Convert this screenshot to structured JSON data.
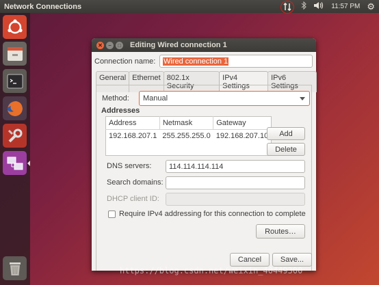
{
  "topbar": {
    "title": "Network Connections",
    "time": "11:57 PM",
    "icons": [
      "network-arrows-icon",
      "bluetooth-icon",
      "volume-icon",
      "gear-icon"
    ]
  },
  "launcher": {
    "items": [
      "ubuntu-dash-icon",
      "files-icon",
      "terminal-icon",
      "firefox-icon",
      "system-settings-icon",
      "network-settings-icon",
      "trash-icon"
    ]
  },
  "dialog": {
    "title": "Editing Wired connection 1",
    "connection_name_label": "Connection name:",
    "connection_name_value": "Wired connection 1",
    "tabs": [
      "General",
      "Ethernet",
      "802.1x Security",
      "IPv4 Settings",
      "IPv6 Settings"
    ],
    "active_tab": "IPv4 Settings",
    "method_label": "Method:",
    "method_value": "Manual",
    "addresses_label": "Addresses",
    "table": {
      "headers": [
        "Address",
        "Netmask",
        "Gateway"
      ],
      "rows": [
        [
          "192.168.207.1",
          "255.255.255.0",
          "192.168.207.10"
        ]
      ]
    },
    "add_label": "Add",
    "delete_label": "Delete",
    "dns_label": "DNS servers:",
    "dns_value": "114.114.114.114",
    "search_domains_label": "Search domains:",
    "search_domains_value": "",
    "dhcp_client_id_label": "DHCP client ID:",
    "dhcp_client_id_value": "",
    "require_ipv4_label": "Require IPv4 addressing for this connection to complete",
    "require_ipv4_checked": false,
    "routes_label": "Routes…",
    "cancel_label": "Cancel",
    "save_label": "Save..."
  },
  "watermark": "https://blog.csdn.net/weixin_40449300",
  "colors": {
    "accent": "#e9663d",
    "panel": "#3c3b37",
    "dialog_bg": "#f2f1ef"
  }
}
